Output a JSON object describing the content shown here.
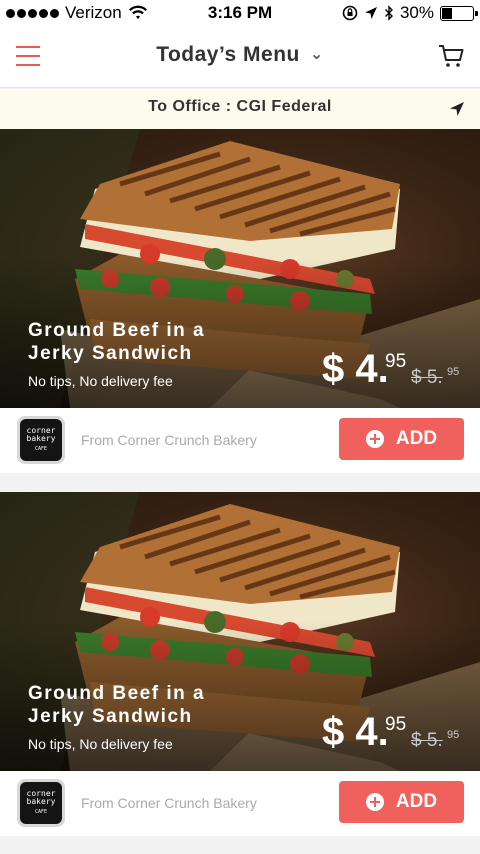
{
  "status_bar": {
    "carrier": "Verizon",
    "time": "3:16 PM",
    "battery": "30%",
    "battery_level": 0.3
  },
  "header": {
    "title": "Today’s Menu"
  },
  "delivery": {
    "text": "To Office : CGI Federal"
  },
  "menu_items": [
    {
      "name_line1": "Ground Beef in a",
      "name_line2": "Jerky Sandwich",
      "note": "No tips, No delivery fee",
      "price_main": "$ 4.",
      "price_cents": "95",
      "old_price_main": "$ 5.",
      "old_price_cents": "95",
      "vendor_logo_top": "corner",
      "vendor_logo_mid": "bakery",
      "vendor_logo_bottom": "CAFE",
      "vendor_text": "From Corner Crunch Bakery",
      "add_label": "ADD"
    },
    {
      "name_line1": "Ground Beef in a",
      "name_line2": "Jerky Sandwich",
      "note": "No tips, No delivery fee",
      "price_main": "$ 4.",
      "price_cents": "95",
      "old_price_main": "$ 5.",
      "old_price_cents": "95",
      "vendor_logo_top": "corner",
      "vendor_logo_mid": "bakery",
      "vendor_logo_bottom": "CAFE",
      "vendor_text": "From Corner Crunch Bakery",
      "add_label": "ADD"
    }
  ],
  "colors": {
    "accent": "#f0605c",
    "menu_icon": "#ea5a57",
    "delivery_bg": "#fdfbee"
  }
}
